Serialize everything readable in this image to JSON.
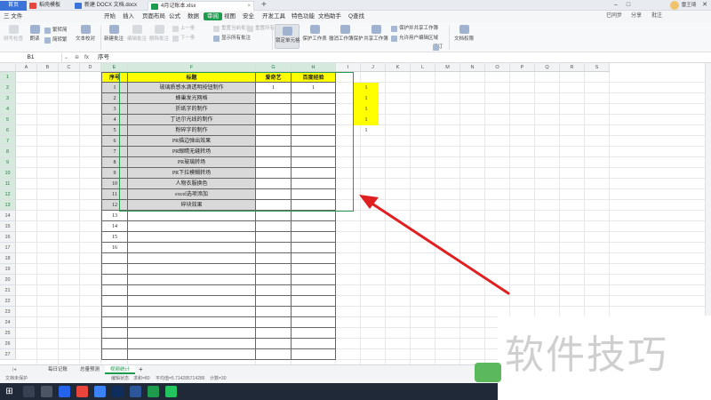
{
  "tabs": {
    "home": "首页",
    "items": [
      {
        "label": "稻壳模板",
        "color": "#e8453c"
      },
      {
        "label": "新建 DOCX 文档.docx",
        "color": "#3b73d9"
      },
      {
        "label": "4月记账本.xlsx",
        "color": "#1e9c4e"
      }
    ],
    "new": "+"
  },
  "window": {
    "minimize": "–",
    "maximize": "□",
    "close": "✕",
    "user": "雷王琦"
  },
  "menu": {
    "file": "三 文件",
    "items": [
      "开始",
      "插入",
      "页面布局",
      "公式",
      "数据",
      "审阅",
      "视图",
      "安全",
      "开发工具",
      "特色功能",
      "文档助手"
    ],
    "selected_index": 5,
    "search": "Q查找",
    "right": [
      "已同步",
      "分享",
      "批注"
    ]
  },
  "ribbon": {
    "big": [
      {
        "label": "拼写检查",
        "disabled": true
      },
      {
        "label": "朗读",
        "disabled": false
      },
      {
        "label": "文本校对",
        "disabled": false
      },
      {
        "label": "新建批注",
        "disabled": false
      },
      {
        "label": "编辑批注",
        "disabled": true
      },
      {
        "label": "删除批注",
        "disabled": true
      },
      {
        "label": "锁定单元格",
        "disabled": false,
        "selected": true
      },
      {
        "label": "保护工作表",
        "disabled": false
      },
      {
        "label": "撤消工作簿保护",
        "disabled": false
      },
      {
        "label": "共享工作簿",
        "disabled": false
      },
      {
        "label": "修订",
        "disabled": false
      },
      {
        "label": "文档权限",
        "disabled": false
      }
    ],
    "small": [
      {
        "label": "繁转简",
        "disabled": false
      },
      {
        "label": "简转繁",
        "disabled": false
      },
      {
        "label": "上一条",
        "disabled": true
      },
      {
        "label": "下一条",
        "disabled": true
      },
      {
        "label": "显示所有批注",
        "disabled": false
      },
      {
        "label": "重置当前批注",
        "disabled": true
      },
      {
        "label": "重置所有批注",
        "disabled": true
      },
      {
        "label": "保护并共享工作簿",
        "disabled": false
      },
      {
        "label": "允许用户编辑区域",
        "disabled": false
      }
    ]
  },
  "formula_bar": {
    "cell_ref": "B1",
    "fx": "fx",
    "content": "序号"
  },
  "columns": [
    "A",
    "B",
    "C",
    "D",
    "E",
    "F",
    "G",
    "H",
    "I",
    "J",
    "K",
    "L",
    "M",
    "N",
    "O",
    "P",
    "Q",
    "R",
    "S"
  ],
  "rows": [
    "1",
    "2",
    "3",
    "4",
    "5",
    "6",
    "7",
    "8",
    "9",
    "10",
    "11",
    "12",
    "13",
    "14",
    "15",
    "16",
    "17",
    "18",
    "19",
    "20",
    "21",
    "22",
    "23",
    "24",
    "25",
    "26",
    "27"
  ],
  "table": {
    "headers": [
      "序号",
      "标题",
      "爱奇艺",
      "百度经验"
    ],
    "rows": [
      [
        "1",
        "玻璃质感水滴透明按钮制作",
        "1",
        "1"
      ],
      [
        "2",
        "蜂巢发光网格",
        "",
        ""
      ],
      [
        "3",
        "折纸字的制作",
        "",
        ""
      ],
      [
        "4",
        "丁达尔光线的制作",
        "",
        ""
      ],
      [
        "5",
        "粉碎字的制作",
        "",
        ""
      ],
      [
        "6",
        "PR描边弹出效果",
        "",
        ""
      ],
      [
        "7",
        "PR眼睛无缝转场",
        "",
        ""
      ],
      [
        "8",
        "PR玻璃转场",
        "",
        ""
      ],
      [
        "9",
        "PR下拉模糊转场",
        "",
        ""
      ],
      [
        "10",
        "人物衣服换色",
        "",
        ""
      ],
      [
        "11",
        "excel选项添加",
        "",
        ""
      ],
      [
        "12",
        "碎块效果",
        "",
        ""
      ],
      [
        "13",
        "",
        "",
        ""
      ],
      [
        "14",
        "",
        "",
        ""
      ],
      [
        "15",
        "",
        "",
        ""
      ],
      [
        "16",
        "",
        "",
        ""
      ],
      [
        "",
        "",
        "",
        ""
      ],
      [
        "",
        "",
        "",
        ""
      ],
      [
        "",
        "",
        "",
        ""
      ],
      [
        "",
        "",
        "",
        ""
      ],
      [
        "",
        "",
        "",
        ""
      ],
      [
        "",
        "",
        "",
        ""
      ],
      [
        "",
        "",
        "",
        ""
      ],
      [
        "",
        "",
        "",
        ""
      ],
      [
        "",
        "",
        "",
        ""
      ],
      [
        "",
        "",
        "",
        ""
      ]
    ],
    "gray_rows": 12,
    "column_i": [
      "1",
      "1",
      "1",
      "1",
      "1"
    ],
    "column_i_yellow": 4
  },
  "sheets": [
    "每日记账",
    "总量预测",
    "视频统计"
  ],
  "active_sheet_index": 2,
  "status": {
    "left": "文档未保护",
    "mode": "编辑状态",
    "sum": "求和=80",
    "avg": "平均值=5.714285714286",
    "count": "计数=30"
  },
  "watermark": "软件技巧",
  "colors": {
    "accent": "#1e9c4e",
    "header_fill": "#ffff00",
    "gray_fill": "#d9d9d9",
    "arrow": "#e02020"
  }
}
